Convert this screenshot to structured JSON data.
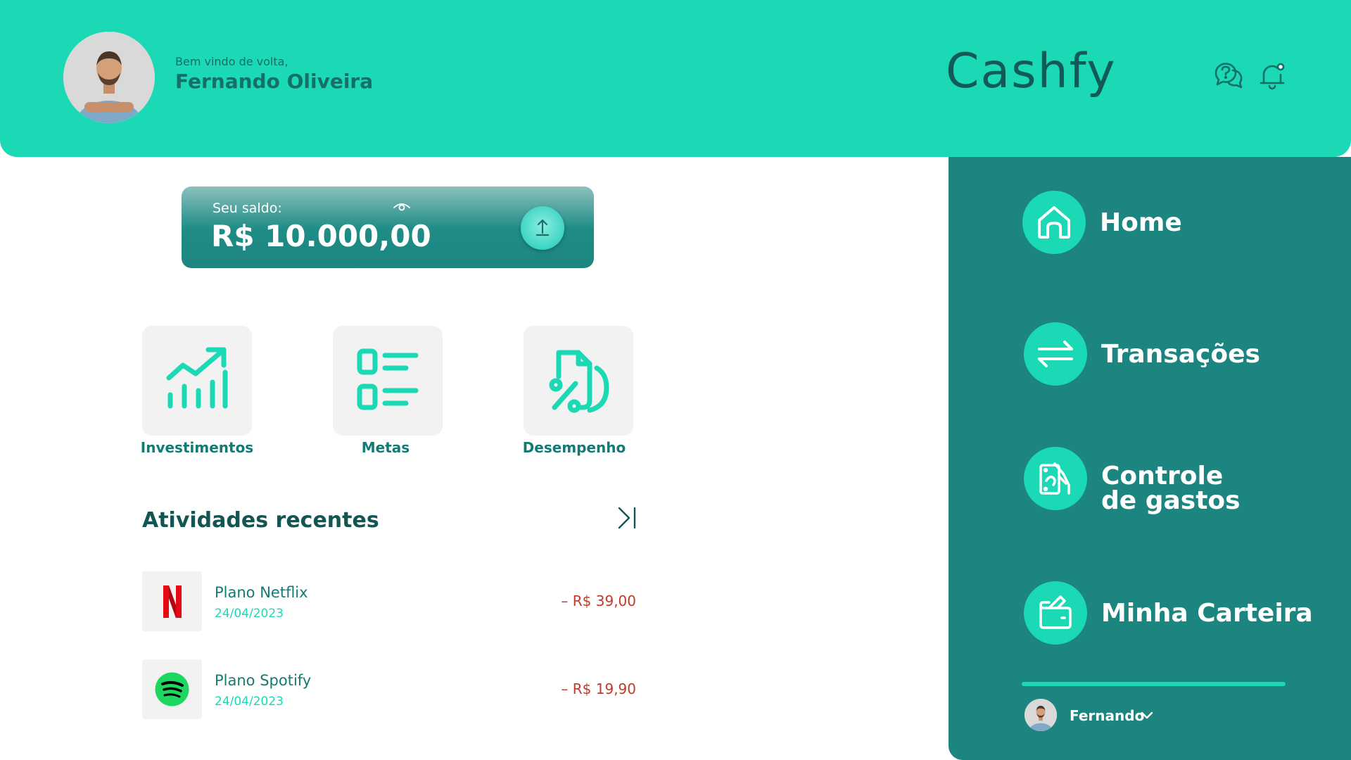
{
  "header": {
    "greeting": "Bem vindo de volta,",
    "user_name": "Fernando Oliveira",
    "brand": "Cashfy",
    "icons": [
      "help-chat-icon",
      "notification-bell-icon"
    ]
  },
  "balance": {
    "label": "Seu saldo:",
    "value": "R$ 10.000,00",
    "icons": [
      "eye-icon",
      "upload-arrow-icon"
    ]
  },
  "shortcuts": [
    {
      "label": "Investimentos",
      "icon": "chart-growth-icon"
    },
    {
      "label": "Metas",
      "icon": "checklist-icon"
    },
    {
      "label": "Desempenho",
      "icon": "percent-document-icon"
    }
  ],
  "activities": {
    "title": "Atividades recentes",
    "items": [
      {
        "name": "Plano Netflix",
        "date": "24/04/2023",
        "amount": "– R$ 39,00",
        "logo": "netflix-logo"
      },
      {
        "name": "Plano Spotify",
        "date": "24/04/2023",
        "amount": "– R$ 19,90",
        "logo": "spotify-logo"
      }
    ]
  },
  "sidebar": {
    "items": [
      {
        "label": "Home",
        "icon": "home-icon"
      },
      {
        "label": "Transações",
        "icon": "transfer-arrows-icon"
      },
      {
        "label_line1": "Controle",
        "label_line2": "de gastos",
        "icon": "expense-control-icon"
      },
      {
        "label": "Minha Carteira",
        "icon": "wallet-icon"
      }
    ],
    "user": {
      "name": "Fernando"
    }
  },
  "colors": {
    "primary": "#1bd9b5",
    "sidebar": "#1d8580",
    "dark_text": "#135553",
    "negative": "#c0392b"
  }
}
